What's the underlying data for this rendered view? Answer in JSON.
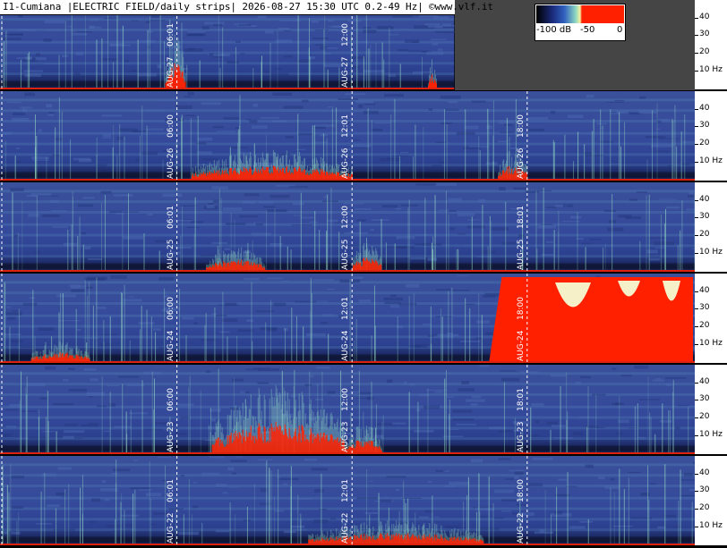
{
  "header": {
    "text": "I1-Cumiana |ELECTRIC FIELD/daily strips| 2026-08-27 15:30 UTC 0.2-49 Hz| ©www.vlf.it"
  },
  "legend": {
    "ticks": [
      "-100 dB",
      "-50",
      "0"
    ]
  },
  "colors": {
    "background": "#2f4694",
    "band_dark": "#101838",
    "burst": "#ff2000",
    "line": "#9fe8c8",
    "nodata": "#454545"
  },
  "chart_data": {
    "type": "heatmap",
    "title": "I1-Cumiana |ELECTRIC FIELD/daily strips| 2026-08-27 15:30 UTC 0.2-49 Hz| ©www.vlf.it",
    "x_range_hours": [
      0,
      24
    ],
    "y_range_hz": [
      0.2,
      49
    ],
    "y_ticks": [
      {
        "hz": 40,
        "label": "40"
      },
      {
        "hz": 30,
        "label": "30"
      },
      {
        "hz": 20,
        "label": "20"
      },
      {
        "hz": 10,
        "label": "10 Hz"
      }
    ],
    "color_scale_db": [
      -100,
      -50,
      0
    ],
    "strips": [
      {
        "date": "AUG-27",
        "data_until_hour": 15.5,
        "ticks": [
          {
            "hour": 6,
            "label": "06:01"
          },
          {
            "hour": 12,
            "label": "12:00"
          }
        ],
        "bursts": [
          [
            5.6,
            6.3,
            0.3
          ],
          [
            14.6,
            14.9,
            0.15
          ]
        ]
      },
      {
        "date": "AUG-26",
        "data_until_hour": 24,
        "ticks": [
          {
            "hour": 6,
            "label": "06:00"
          },
          {
            "hour": 12,
            "label": "12:01"
          },
          {
            "hour": 18,
            "label": "18:00"
          }
        ],
        "bursts": [
          [
            6.5,
            12.0,
            0.15
          ],
          [
            17.0,
            18.0,
            0.15
          ]
        ]
      },
      {
        "date": "AUG-25",
        "data_until_hour": 24,
        "ticks": [
          {
            "hour": 6,
            "label": "06:01"
          },
          {
            "hour": 12,
            "label": "12:00"
          },
          {
            "hour": 18,
            "label": "18:01"
          }
        ],
        "bursts": [
          [
            7.0,
            9.0,
            0.12
          ],
          [
            12.0,
            13.0,
            0.15
          ]
        ]
      },
      {
        "date": "AUG-24",
        "data_until_hour": 24,
        "ticks": [
          {
            "hour": 6,
            "label": "06:00"
          },
          {
            "hour": 12,
            "label": "12:01"
          },
          {
            "hour": 18,
            "label": "18:00"
          }
        ],
        "bursts": [
          [
            1.0,
            3.0,
            0.1
          ]
        ],
        "saturated_from_hour": 16.7
      },
      {
        "date": "AUG-23",
        "data_until_hour": 24,
        "ticks": [
          {
            "hour": 6,
            "label": "06:00"
          },
          {
            "hour": 12,
            "label": "12:00"
          },
          {
            "hour": 18,
            "label": "18:01"
          }
        ],
        "bursts": [
          [
            7.2,
            11.8,
            0.35
          ],
          [
            11.8,
            13.0,
            0.15
          ]
        ]
      },
      {
        "date": "AUG-22",
        "data_until_hour": 24,
        "ticks": [
          {
            "hour": 6,
            "label": "06:01"
          },
          {
            "hour": 12,
            "label": "12:01"
          },
          {
            "hour": 18,
            "label": "18:00"
          }
        ],
        "bursts": [
          [
            10.5,
            16.5,
            0.12
          ]
        ]
      }
    ]
  }
}
